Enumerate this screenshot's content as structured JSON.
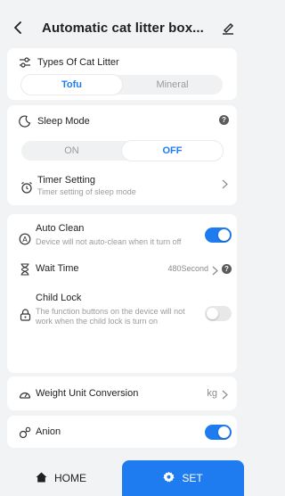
{
  "header": {
    "title": "Automatic cat litter box...",
    "back_icon": "chevron-left-icon",
    "edit_icon": "edit-icon"
  },
  "litter": {
    "label": "Types Of Cat Litter",
    "options": [
      "Tofu",
      "Mineral"
    ],
    "selected": "Tofu"
  },
  "sleep": {
    "label": "Sleep Mode",
    "options": [
      "ON",
      "OFF"
    ],
    "selected": "OFF",
    "timer_label": "Timer Setting",
    "timer_desc": "Timer setting of sleep mode"
  },
  "auto_clean": {
    "label": "Auto Clean",
    "desc": "Device will not auto-clean when it turn off",
    "enabled": true
  },
  "wait_time": {
    "label": "Wait Time",
    "value": "480Second"
  },
  "child_lock": {
    "label": "Child Lock",
    "desc_line1": "The function buttons on the device will not",
    "desc_line2": "work when the child lock is turn on",
    "enabled": false
  },
  "weight_unit": {
    "label": "Weight Unit Conversion",
    "value": "kg"
  },
  "anion": {
    "label": "Anion",
    "enabled": true
  },
  "bottom_nav": {
    "home_label": "HOME",
    "set_label": "SET",
    "active": "SET"
  },
  "colors": {
    "accent": "#1e7cf0",
    "background": "#f2f3f5",
    "card": "#ffffff"
  }
}
